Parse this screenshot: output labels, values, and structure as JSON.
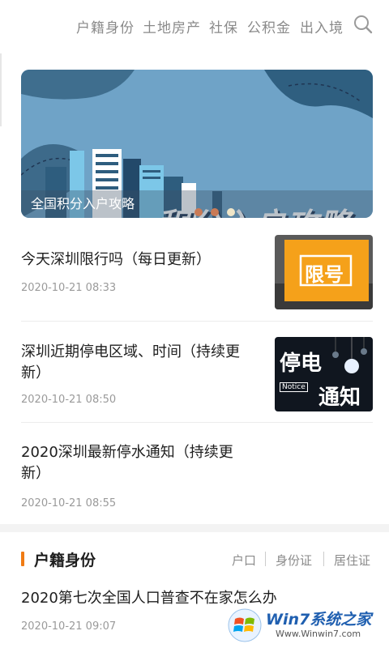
{
  "nav": {
    "items": [
      "户籍身份",
      "土地房产",
      "社保",
      "公积金",
      "出入境"
    ],
    "search_icon": "search-icon"
  },
  "banner": {
    "art_title": "积分入户攻略",
    "caption": "全国积分入户攻略",
    "dots": 3,
    "active_dot": 2
  },
  "news": [
    {
      "title_lines": [
        "今天深圳限行吗（每日更新）"
      ],
      "date": "2020-10-21 08:33",
      "thumb_text": "限号"
    },
    {
      "title_lines": [
        "深圳近期停电区域、时间（持续更",
        "新）"
      ],
      "date": "2020-10-21 08:50",
      "thumb_text_top": "停电",
      "thumb_text_small": "Notice",
      "thumb_text_bottom": "通知"
    },
    {
      "title_lines": [
        "2020深圳最新停水通知（持续更",
        "新）"
      ],
      "date": "2020-10-21 08:55"
    }
  ],
  "section": {
    "title": "户籍身份",
    "tabs": [
      "户口",
      "身份证",
      "居住证"
    ],
    "items": [
      {
        "title": "2020第七次全国人口普查不在家怎么办",
        "date": "2020-10-21 09:07"
      }
    ]
  },
  "watermark": {
    "text_main": "Win7系统之家",
    "text_url": "Www.Winwin7.com"
  },
  "colors": {
    "accent": "#f07b14",
    "banner_bg": "#6fa3c7",
    "thumb_orange": "#f5a11a"
  }
}
